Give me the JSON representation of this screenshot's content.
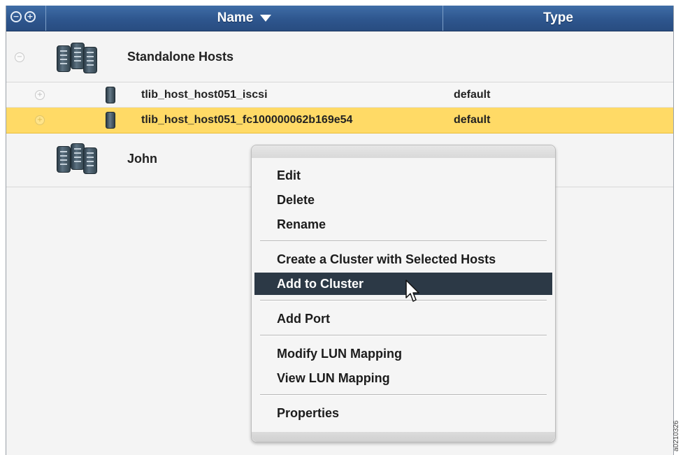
{
  "header": {
    "collapse_all_symbol": "−",
    "expand_all_symbol": "+",
    "name_label": "Name",
    "type_label": "Type"
  },
  "tree": {
    "groups": [
      {
        "label": "Standalone Hosts",
        "expand_symbol": "−",
        "hosts": [
          {
            "name": "tlib_host_host051_iscsi",
            "type": "default",
            "selected": false,
            "expand_symbol": "+"
          },
          {
            "name": "tlib_host_host051_fc100000062b169e54",
            "type": "default",
            "selected": true,
            "expand_symbol": "+"
          }
        ]
      },
      {
        "label": "John"
      }
    ]
  },
  "context_menu": {
    "items": [
      "Edit",
      "Delete",
      "Rename",
      "Create a Cluster with Selected Hosts",
      "Add to Cluster",
      "Add Port",
      "Modify LUN Mapping",
      "View LUN Mapping",
      "Properties"
    ],
    "active_item": "Add to Cluster"
  },
  "figure_id": "a0210326"
}
